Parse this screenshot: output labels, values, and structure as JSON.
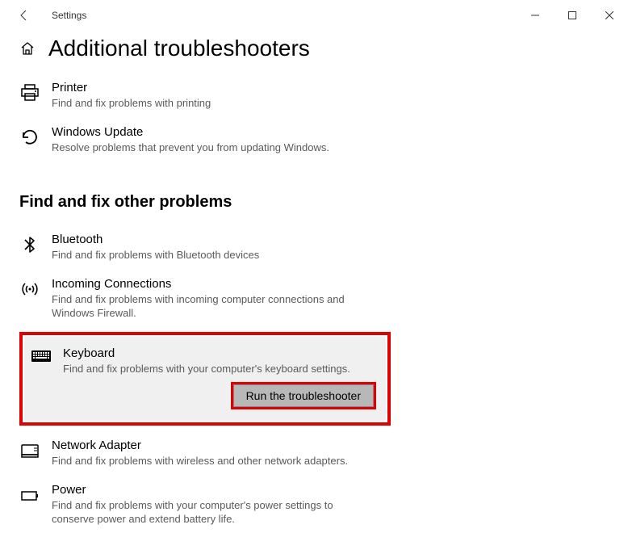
{
  "window": {
    "title": "Settings"
  },
  "page": {
    "heading": "Additional troubleshooters"
  },
  "topItems": [
    {
      "title": "Printer",
      "desc": "Find and fix problems with printing"
    },
    {
      "title": "Windows Update",
      "desc": "Resolve problems that prevent you from updating Windows."
    }
  ],
  "section2": {
    "heading": "Find and fix other problems"
  },
  "otherItems": [
    {
      "title": "Bluetooth",
      "desc": "Find and fix problems with Bluetooth devices"
    },
    {
      "title": "Incoming Connections",
      "desc": "Find and fix problems with incoming computer connections and Windows Firewall."
    }
  ],
  "selected": {
    "title": "Keyboard",
    "desc": "Find and fix problems with your computer's keyboard settings.",
    "button": "Run the troubleshooter"
  },
  "afterItems": [
    {
      "title": "Network Adapter",
      "desc": "Find and fix problems with wireless and other network adapters."
    },
    {
      "title": "Power",
      "desc": "Find and fix problems with your computer's power settings to conserve power and extend battery life."
    }
  ]
}
